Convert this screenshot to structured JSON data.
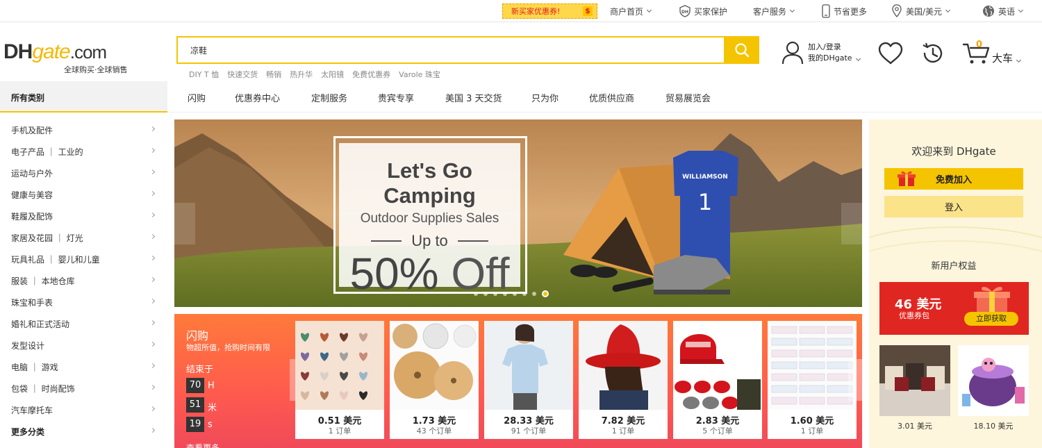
{
  "topbar": {
    "coupon_chip": "新买家优惠券!",
    "coupon_symbol": "$",
    "merchant_home": "商户首页",
    "buyer_protection": "买家保护",
    "customer_service": "客户服务",
    "save_more": "节省更多",
    "region_currency": "美国/美元",
    "language": "英语"
  },
  "header": {
    "logo_main": "DH",
    "logo_gate": "gate",
    "logo_com": ".com",
    "logo_tagline": "全球购买·全球销售",
    "search_value": "凉鞋",
    "hot_words": [
      "DIY T 恤",
      "快速交货",
      "畅销",
      "热升华",
      "太阳镜",
      "免费优惠券",
      "Varole 珠宝"
    ],
    "account_line1": "加入/登录",
    "account_line2": "我的DHgate",
    "cart_count": "0",
    "cart_label": "大车"
  },
  "nav": {
    "all_categories": "所有类别",
    "items": [
      "闪购",
      "优惠券中心",
      "定制服务",
      "贵宾专享",
      "美国 3 天交货",
      "只为你",
      "优质供应商",
      "贸易展览会"
    ]
  },
  "sidebar": {
    "categories": [
      "手机及配件",
      "电子产品 ｜ 工业的",
      "运动与户外",
      "健康与美容",
      "鞋履及配饰",
      "家居及花园 ｜ 灯光",
      "玩具礼品 ｜ 婴儿和儿童",
      "服装 ｜ 本地仓库",
      "珠宝和手表",
      "婚礼和正式活动",
      "发型设计",
      "电脑 ｜ 游戏",
      "包袋 ｜ 时尚配饰",
      "汽车摩托车"
    ],
    "more": "更多分类"
  },
  "banner": {
    "title": "Let's Go Camping",
    "subtitle": "Outdoor Supplies Sales",
    "upto": "Up to",
    "percent": "50%",
    "off": "Off",
    "jersey_name": "WILLIAMSON",
    "jersey_number": "1"
  },
  "flash_sale": {
    "title": "闪购",
    "desc": "物超所值，抢购时间有限",
    "ends_in": "结束于",
    "timer": [
      {
        "value": "70",
        "unit": "H"
      },
      {
        "value": "51",
        "unit": "米"
      },
      {
        "value": "19",
        "unit": "s"
      }
    ],
    "view_more": "查看更多",
    "products": [
      {
        "price": "0.51 美元",
        "orders": "1 订单",
        "image": "heart-stones"
      },
      {
        "price": "1.73 美元",
        "orders": "43 个订单",
        "image": "bamboo-lids"
      },
      {
        "price": "28.33 美元",
        "orders": "91 个订单",
        "image": "woman-tshirt"
      },
      {
        "price": "7.82 美元",
        "orders": "1 订单",
        "image": "red-hat"
      },
      {
        "price": "2.83 美元",
        "orders": "5 个订单",
        "image": "red-caps"
      },
      {
        "price": "1.60 美元",
        "orders": "1 订单",
        "image": "tickets"
      }
    ]
  },
  "right_panel": {
    "welcome": "欢迎来到 DHgate",
    "join": "免费加入",
    "login": "登入",
    "benefits": "新用户权益",
    "coupon_amount": "46 美元",
    "coupon_desc": "优惠券包",
    "claim": "立即获取",
    "products": [
      {
        "price": "3.01 美元",
        "image": "cushions"
      },
      {
        "price": "18.10 美元",
        "image": "toy-cauldron"
      }
    ]
  },
  "colors": {
    "brand_yellow": "#f5c400",
    "flash_red": "#ff5a4e",
    "coupon_red": "#e02620"
  }
}
